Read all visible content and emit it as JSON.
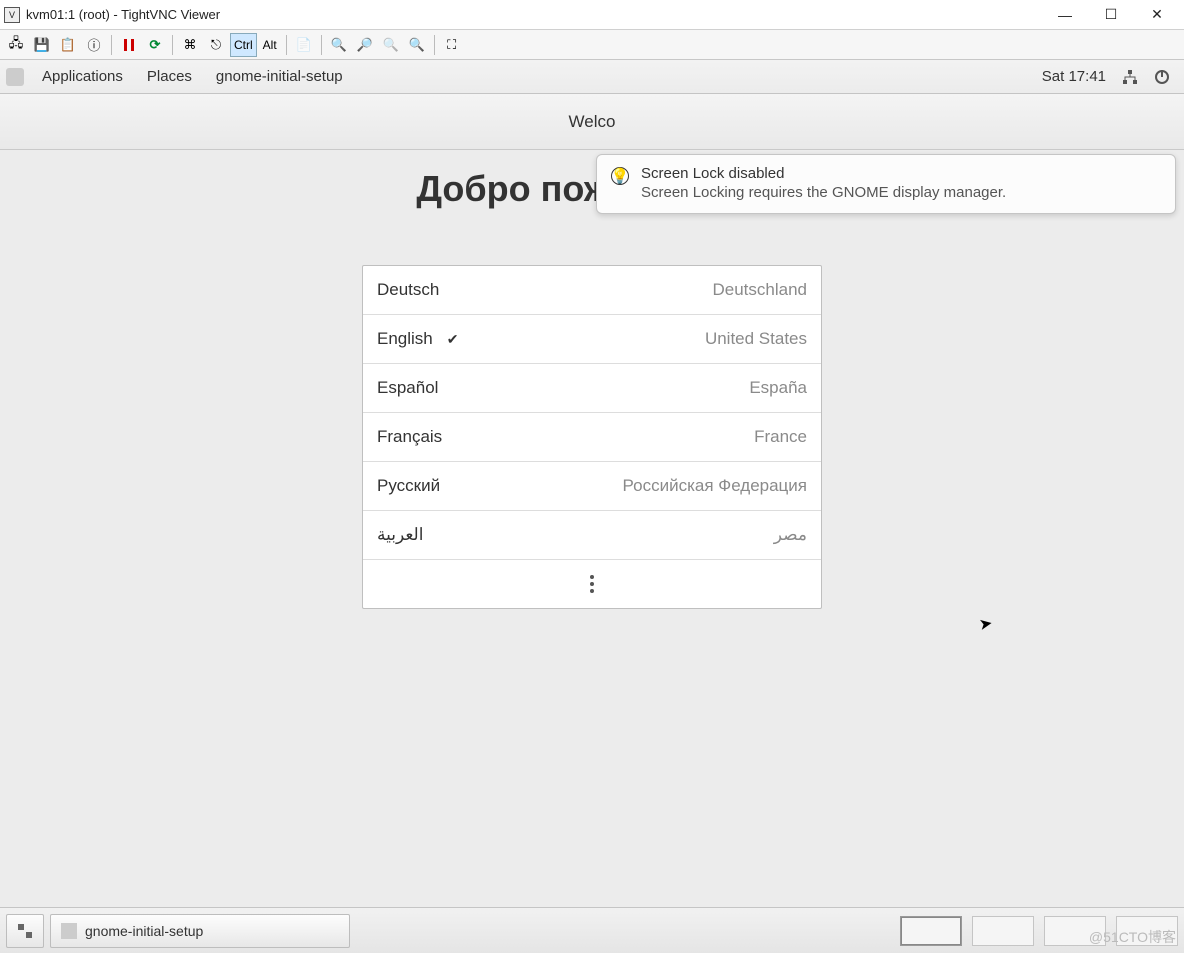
{
  "window": {
    "title": "kvm01:1 (root) - TightVNC Viewer",
    "controls": {
      "minimize": "—",
      "maximize": "☐",
      "close": "✕"
    }
  },
  "vnc_toolbar": {
    "ctrl": "Ctrl",
    "alt": "Alt"
  },
  "gnome": {
    "applications": "Applications",
    "places": "Places",
    "app": "gnome-initial-setup",
    "clock": "Sat 17:41"
  },
  "subbar": {
    "title": "Welco"
  },
  "welcome": {
    "heading": "Добро пожаловать!"
  },
  "languages": [
    {
      "name": "Deutsch",
      "country": "Deutschland",
      "selected": false
    },
    {
      "name": "English",
      "country": "United States",
      "selected": true
    },
    {
      "name": "Español",
      "country": "España",
      "selected": false
    },
    {
      "name": "Français",
      "country": "France",
      "selected": false
    },
    {
      "name": "Русский",
      "country": "Российская Федерация",
      "selected": false
    },
    {
      "name": "العربية",
      "country": "مصر",
      "selected": false
    }
  ],
  "notification": {
    "title": "Screen Lock disabled",
    "body": "Screen Locking requires the GNOME display manager."
  },
  "taskbar": {
    "app_label": "gnome-initial-setup"
  },
  "watermark": "@51CTO博客"
}
